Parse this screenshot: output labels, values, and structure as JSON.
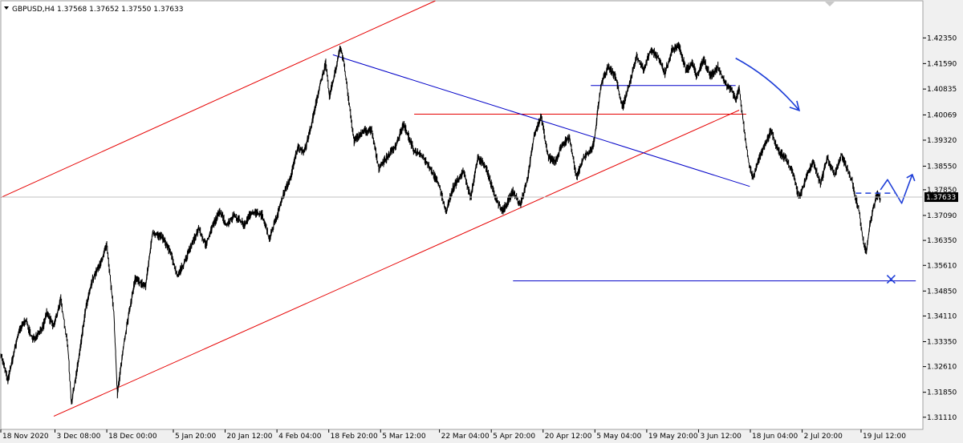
{
  "header": {
    "symbol_line": "GBPUSD,H4  1.37568 1.37652 1.37550 1.37633"
  },
  "colors": {
    "background": "#ffffff",
    "frame": "#f0f0f0",
    "candles": "#000000",
    "red_lines": "#e60000",
    "blue_lines": "#0000c8",
    "annotations": "#1f3fd8",
    "price_line": "#c0c0c0",
    "price_tag_bg": "#000000"
  },
  "chart_data": {
    "type": "line",
    "symbol": "GBPUSD",
    "timeframe": "H4",
    "ohlc_current": {
      "open": 1.37568,
      "high": 1.37652,
      "low": 1.3755,
      "close": 1.37633
    },
    "ylim": [
      1.3075,
      1.4345
    ],
    "y_ticks": [
      1.4235,
      1.4159,
      1.40835,
      1.40069,
      1.3932,
      1.3855,
      1.3785,
      1.3709,
      1.3635,
      1.3561,
      1.3485,
      1.3411,
      1.3335,
      1.3261,
      1.3185,
      1.3111
    ],
    "y_tick_labels": [
      "1.42350",
      "1.41590",
      "1.40835",
      "1.40069",
      "1.39320",
      "1.38550",
      "1.37850",
      "1.37090",
      "1.36350",
      "1.35610",
      "1.34850",
      "1.34110",
      "1.33350",
      "1.32610",
      "1.31850",
      "1.31110"
    ],
    "x_range": [
      "2020-11-18",
      "2021-08-06"
    ],
    "x_ticks": [
      "2020-11-18 00:00",
      "2020-12-03 08:00",
      "2020-12-18 00:00",
      "2021-01-05 20:00",
      "2021-01-20 12:00",
      "2021-02-04 04:00",
      "2021-02-18 20:00",
      "2021-03-05 12:00",
      "2021-03-22 04:00",
      "2021-04-05 20:00",
      "2021-04-20 12:00",
      "2021-05-05 04:00",
      "2021-05-19 20:00",
      "2021-06-03 12:00",
      "2021-06-18 04:00",
      "2021-07-02 20:00",
      "2021-07-19 12:00"
    ],
    "x_tick_labels": [
      "18 Nov 2020",
      "3 Dec 08:00",
      "18 Dec 00:00",
      "5 Jan 20:00",
      "20 Jan 12:00",
      "4 Feb 04:00",
      "18 Feb 20:00",
      "5 Mar 12:00",
      "22 Mar 04:00",
      "5 Apr 20:00",
      "20 Apr 12:00",
      "5 May 04:00",
      "19 May 20:00",
      "3 Jun 12:00",
      "18 Jun 04:00",
      "2 Jul 20:00",
      "19 Jul 12:00"
    ],
    "current_price": 1.37633,
    "current_price_label": "1.37633",
    "price_series": [
      [
        "2020-11-18",
        1.33
      ],
      [
        "2020-11-20",
        1.322
      ],
      [
        "2020-11-23",
        1.336
      ],
      [
        "2020-11-25",
        1.34
      ],
      [
        "2020-11-27",
        1.334
      ],
      [
        "2020-11-30",
        1.338
      ],
      [
        "2020-12-01",
        1.342
      ],
      [
        "2020-12-03",
        1.338
      ],
      [
        "2020-12-05",
        1.346
      ],
      [
        "2020-12-07",
        1.332
      ],
      [
        "2020-12-08",
        1.315
      ],
      [
        "2020-12-10",
        1.328
      ],
      [
        "2020-12-12",
        1.343
      ],
      [
        "2020-12-14",
        1.352
      ],
      [
        "2020-12-16",
        1.356
      ],
      [
        "2020-12-18",
        1.362
      ],
      [
        "2020-12-20",
        1.342
      ],
      [
        "2020-12-21",
        1.318
      ],
      [
        "2020-12-23",
        1.334
      ],
      [
        "2020-12-26",
        1.352
      ],
      [
        "2020-12-29",
        1.35
      ],
      [
        "2020-12-31",
        1.366
      ],
      [
        "2021-01-03",
        1.364
      ],
      [
        "2021-01-05",
        1.36
      ],
      [
        "2021-01-07",
        1.353
      ],
      [
        "2021-01-09",
        1.357
      ],
      [
        "2021-01-11",
        1.362
      ],
      [
        "2021-01-13",
        1.367
      ],
      [
        "2021-01-15",
        1.362
      ],
      [
        "2021-01-17",
        1.368
      ],
      [
        "2021-01-19",
        1.372
      ],
      [
        "2021-01-21",
        1.368
      ],
      [
        "2021-01-23",
        1.371
      ],
      [
        "2021-01-26",
        1.368
      ],
      [
        "2021-01-28",
        1.372
      ],
      [
        "2021-01-31",
        1.371
      ],
      [
        "2021-02-02",
        1.364
      ],
      [
        "2021-02-04",
        1.37
      ],
      [
        "2021-02-06",
        1.377
      ],
      [
        "2021-02-08",
        1.382
      ],
      [
        "2021-02-10",
        1.391
      ],
      [
        "2021-02-12",
        1.39
      ],
      [
        "2021-02-14",
        1.398
      ],
      [
        "2021-02-16",
        1.408
      ],
      [
        "2021-02-18",
        1.416
      ],
      [
        "2021-02-19",
        1.406
      ],
      [
        "2021-02-21",
        1.415
      ],
      [
        "2021-02-22",
        1.421
      ],
      [
        "2021-02-23",
        1.417
      ],
      [
        "2021-02-24",
        1.409
      ],
      [
        "2021-02-26",
        1.393
      ],
      [
        "2021-03-01",
        1.396
      ],
      [
        "2021-03-03",
        1.396
      ],
      [
        "2021-03-05",
        1.385
      ],
      [
        "2021-03-08",
        1.389
      ],
      [
        "2021-03-10",
        1.392
      ],
      [
        "2021-03-12",
        1.398
      ],
      [
        "2021-03-15",
        1.39
      ],
      [
        "2021-03-17",
        1.389
      ],
      [
        "2021-03-19",
        1.386
      ],
      [
        "2021-03-22",
        1.38
      ],
      [
        "2021-03-24",
        1.372
      ],
      [
        "2021-03-26",
        1.379
      ],
      [
        "2021-03-29",
        1.384
      ],
      [
        "2021-03-31",
        1.376
      ],
      [
        "2021-04-02",
        1.388
      ],
      [
        "2021-04-04",
        1.386
      ],
      [
        "2021-04-05",
        1.383
      ],
      [
        "2021-04-07",
        1.376
      ],
      [
        "2021-04-09",
        1.372
      ],
      [
        "2021-04-12",
        1.378
      ],
      [
        "2021-04-14",
        1.374
      ],
      [
        "2021-04-16",
        1.381
      ],
      [
        "2021-04-18",
        1.395
      ],
      [
        "2021-04-20",
        1.4
      ],
      [
        "2021-04-22",
        1.388
      ],
      [
        "2021-04-24",
        1.387
      ],
      [
        "2021-04-26",
        1.392
      ],
      [
        "2021-04-28",
        1.394
      ],
      [
        "2021-04-30",
        1.382
      ],
      [
        "2021-05-02",
        1.388
      ],
      [
        "2021-05-04",
        1.39
      ],
      [
        "2021-05-05",
        1.393
      ],
      [
        "2021-05-06",
        1.402
      ],
      [
        "2021-05-07",
        1.41
      ],
      [
        "2021-05-09",
        1.415
      ],
      [
        "2021-05-11",
        1.412
      ],
      [
        "2021-05-13",
        1.403
      ],
      [
        "2021-05-15",
        1.41
      ],
      [
        "2021-05-17",
        1.418
      ],
      [
        "2021-05-19",
        1.414
      ],
      [
        "2021-05-21",
        1.42
      ],
      [
        "2021-05-23",
        1.418
      ],
      [
        "2021-05-25",
        1.413
      ],
      [
        "2021-05-27",
        1.42
      ],
      [
        "2021-05-29",
        1.421
      ],
      [
        "2021-05-31",
        1.414
      ],
      [
        "2021-06-02",
        1.416
      ],
      [
        "2021-06-03",
        1.412
      ],
      [
        "2021-06-05",
        1.417
      ],
      [
        "2021-06-07",
        1.412
      ],
      [
        "2021-06-09",
        1.415
      ],
      [
        "2021-06-11",
        1.41
      ],
      [
        "2021-06-13",
        1.408
      ],
      [
        "2021-06-14",
        1.405
      ],
      [
        "2021-06-15",
        1.409
      ],
      [
        "2021-06-16",
        1.4
      ],
      [
        "2021-06-17",
        1.392
      ],
      [
        "2021-06-18",
        1.385
      ],
      [
        "2021-06-19",
        1.382
      ],
      [
        "2021-06-20",
        1.386
      ],
      [
        "2021-06-22",
        1.391
      ],
      [
        "2021-06-24",
        1.396
      ],
      [
        "2021-06-26",
        1.39
      ],
      [
        "2021-06-28",
        1.388
      ],
      [
        "2021-06-30",
        1.384
      ],
      [
        "2021-07-01",
        1.38
      ],
      [
        "2021-07-02",
        1.376
      ],
      [
        "2021-07-04",
        1.382
      ],
      [
        "2021-07-06",
        1.387
      ],
      [
        "2021-07-08",
        1.38
      ],
      [
        "2021-07-10",
        1.388
      ],
      [
        "2021-07-12",
        1.383
      ],
      [
        "2021-07-14",
        1.389
      ],
      [
        "2021-07-15",
        1.386
      ],
      [
        "2021-07-17",
        1.381
      ],
      [
        "2021-07-18",
        1.376
      ],
      [
        "2021-07-19",
        1.372
      ],
      [
        "2021-07-20",
        1.364
      ],
      [
        "2021-07-21",
        1.36
      ],
      [
        "2021-07-22",
        1.368
      ],
      [
        "2021-07-23",
        1.373
      ],
      [
        "2021-07-24",
        1.377
      ],
      [
        "2021-07-25",
        1.376
      ]
    ],
    "price_noise": 0.0016,
    "drawings": [
      {
        "kind": "trendline",
        "color": "red",
        "from": [
          "2020-11-18",
          1.3762
        ],
        "to": [
          "2021-03-21",
          1.4345
        ]
      },
      {
        "kind": "trendline",
        "color": "red",
        "from": [
          "2020-12-03",
          1.3114
        ],
        "to": [
          "2021-06-15",
          1.4021
        ]
      },
      {
        "kind": "segment",
        "color": "red",
        "from": [
          "2021-03-15",
          1.4009
        ],
        "to": [
          "2021-06-17",
          1.4009
        ]
      },
      {
        "kind": "trendline",
        "color": "blue",
        "from": [
          "2021-02-20",
          1.4185
        ],
        "to": [
          "2021-06-18",
          1.3795
        ]
      },
      {
        "kind": "segment",
        "color": "blue",
        "from": [
          "2021-05-04",
          1.4094
        ],
        "to": [
          "2021-06-14",
          1.4094
        ]
      },
      {
        "kind": "segment",
        "color": "blue",
        "from": [
          "2021-04-12",
          1.3515
        ],
        "to": [
          "2021-08-04",
          1.3515
        ]
      }
    ],
    "annotations": [
      {
        "kind": "arrow-down-right",
        "color": "blue",
        "from": [
          "2021-06-14",
          1.4175
        ],
        "to": [
          "2021-07-02",
          1.402
        ]
      },
      {
        "kind": "dashed-level",
        "color": "blue",
        "from": [
          "2021-07-18",
          1.3775
        ],
        "to": [
          "2021-07-29",
          1.3775
        ]
      },
      {
        "kind": "projection-arrow",
        "color": "blue",
        "points": [
          [
            "2021-07-25",
            1.3785
          ],
          [
            "2021-07-27",
            1.3815
          ],
          [
            "2021-07-31",
            1.3745
          ],
          [
            "2021-08-03",
            1.383
          ]
        ]
      },
      {
        "kind": "cross-marker",
        "color": "blue",
        "at": [
          "2021-07-28",
          1.352
        ]
      }
    ]
  }
}
